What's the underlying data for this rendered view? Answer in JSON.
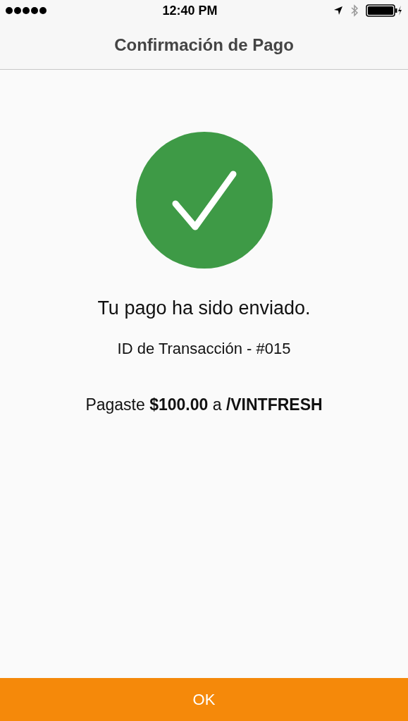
{
  "status_bar": {
    "time": "12:40 PM"
  },
  "nav_bar": {
    "title": "Confirmación de Pago"
  },
  "confirmation": {
    "message": "Tu pago ha sido enviado.",
    "transaction_id": "ID de Transacción - #015",
    "summary": "Pagaste **$100.00** a **/VINTFRESH**"
  },
  "ok_button": {
    "label": "OK"
  }
}
